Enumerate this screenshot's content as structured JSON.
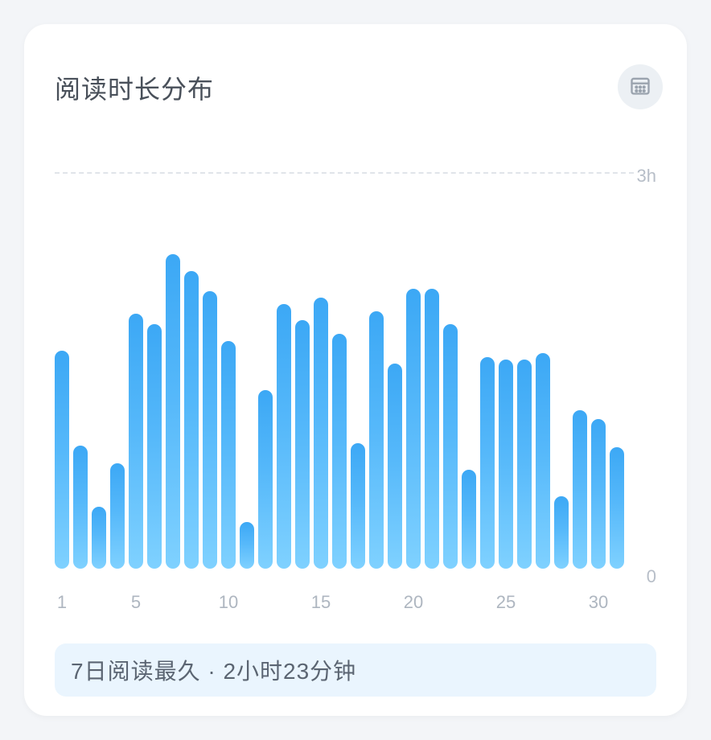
{
  "header": {
    "title": "阅读时长分布"
  },
  "yaxis": {
    "max_label": "3h",
    "min_label": "0"
  },
  "xaxis_ticks": [
    1,
    5,
    10,
    15,
    20,
    25,
    30
  ],
  "banner": {
    "text": "7日阅读最久 · 2小时23分钟"
  },
  "chart_data": {
    "type": "bar",
    "title": "阅读时长分布",
    "xlabel": "",
    "ylabel": "",
    "ylim": [
      0,
      3
    ],
    "y_unit": "hours",
    "categories": [
      1,
      2,
      3,
      4,
      5,
      6,
      7,
      8,
      9,
      10,
      11,
      12,
      13,
      14,
      15,
      16,
      17,
      18,
      19,
      20,
      21,
      22,
      23,
      24,
      25,
      26,
      27,
      28,
      29,
      30,
      31
    ],
    "values": [
      1.65,
      0.93,
      0.47,
      0.8,
      1.93,
      1.85,
      2.38,
      2.25,
      2.1,
      1.72,
      0.35,
      1.35,
      2.0,
      1.88,
      2.05,
      1.78,
      0.95,
      1.95,
      1.55,
      2.12,
      2.12,
      1.85,
      0.75,
      1.6,
      1.58,
      1.58,
      1.63,
      0.55,
      1.2,
      1.13,
      0.92
    ]
  }
}
